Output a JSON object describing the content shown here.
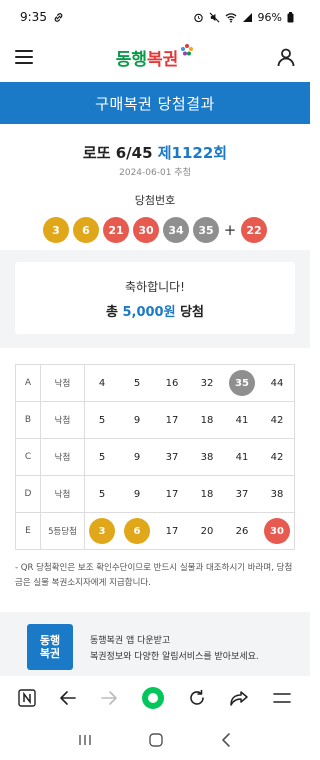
{
  "status": {
    "time": "9:35",
    "battery": "96%"
  },
  "app": {
    "logo_main": "동행",
    "logo_accent": "복권"
  },
  "page_title": "구매복권 당첨결과",
  "draw": {
    "game": "로또 6/45",
    "round": "제1122회",
    "date": "2024-06-01 추첨",
    "winning_label": "당첨번호",
    "numbers": [
      {
        "num": "3",
        "color": "#e0a71b"
      },
      {
        "num": "6",
        "color": "#e0a71b"
      },
      {
        "num": "21",
        "color": "#e65a4f"
      },
      {
        "num": "30",
        "color": "#e65a4f"
      },
      {
        "num": "34",
        "color": "#8f8f8f"
      },
      {
        "num": "35",
        "color": "#8f8f8f"
      }
    ],
    "plus": "+",
    "bonus": {
      "num": "22",
      "color": "#e65a4f"
    }
  },
  "congrats": {
    "line1": "축하합니다!",
    "prefix": "총",
    "amount": "5,000원",
    "suffix": "당첨"
  },
  "tickets": [
    {
      "label": "A",
      "result": "낙첨",
      "nums": [
        {
          "n": "4"
        },
        {
          "n": "5"
        },
        {
          "n": "16"
        },
        {
          "n": "32"
        },
        {
          "n": "35",
          "hit": "#8f8f8f"
        },
        {
          "n": "44"
        }
      ]
    },
    {
      "label": "B",
      "result": "낙첨",
      "nums": [
        {
          "n": "5"
        },
        {
          "n": "9"
        },
        {
          "n": "17"
        },
        {
          "n": "18"
        },
        {
          "n": "41"
        },
        {
          "n": "42"
        }
      ]
    },
    {
      "label": "C",
      "result": "낙첨",
      "nums": [
        {
          "n": "5"
        },
        {
          "n": "9"
        },
        {
          "n": "37"
        },
        {
          "n": "38"
        },
        {
          "n": "41"
        },
        {
          "n": "42"
        }
      ]
    },
    {
      "label": "D",
      "result": "낙첨",
      "nums": [
        {
          "n": "5"
        },
        {
          "n": "9"
        },
        {
          "n": "17"
        },
        {
          "n": "18"
        },
        {
          "n": "37"
        },
        {
          "n": "38"
        }
      ]
    },
    {
      "label": "E",
      "result": "5등당첨",
      "nums": [
        {
          "n": "3",
          "hit": "#e0a71b"
        },
        {
          "n": "6",
          "hit": "#e0a71b"
        },
        {
          "n": "17"
        },
        {
          "n": "20"
        },
        {
          "n": "26"
        },
        {
          "n": "30",
          "hit": "#e65a4f"
        }
      ]
    }
  ],
  "notice": "- QR 당첨확인은 보조 확인수단이므로 반드시 실물과 대조하시기 바라며, 당첨금은 실물 복권소지자에게 지급합니다.",
  "promo": {
    "logo_line1": "동행",
    "logo_line2": "복권",
    "line1": "동행복권 앱 다운받고",
    "line2": "복권정보와 다양한 알림서비스를 받아보세요."
  },
  "icons": {
    "menu": "hamburger-menu-icon",
    "account": "user-icon",
    "browser": [
      "n-logo-icon",
      "back-arrow-icon",
      "forward-arrow-icon",
      "green-home-dot-icon",
      "refresh-icon",
      "share-icon",
      "menu-lines-icon"
    ],
    "system_nav": [
      "recents-icon",
      "home-icon",
      "back-chevron-icon"
    ]
  }
}
